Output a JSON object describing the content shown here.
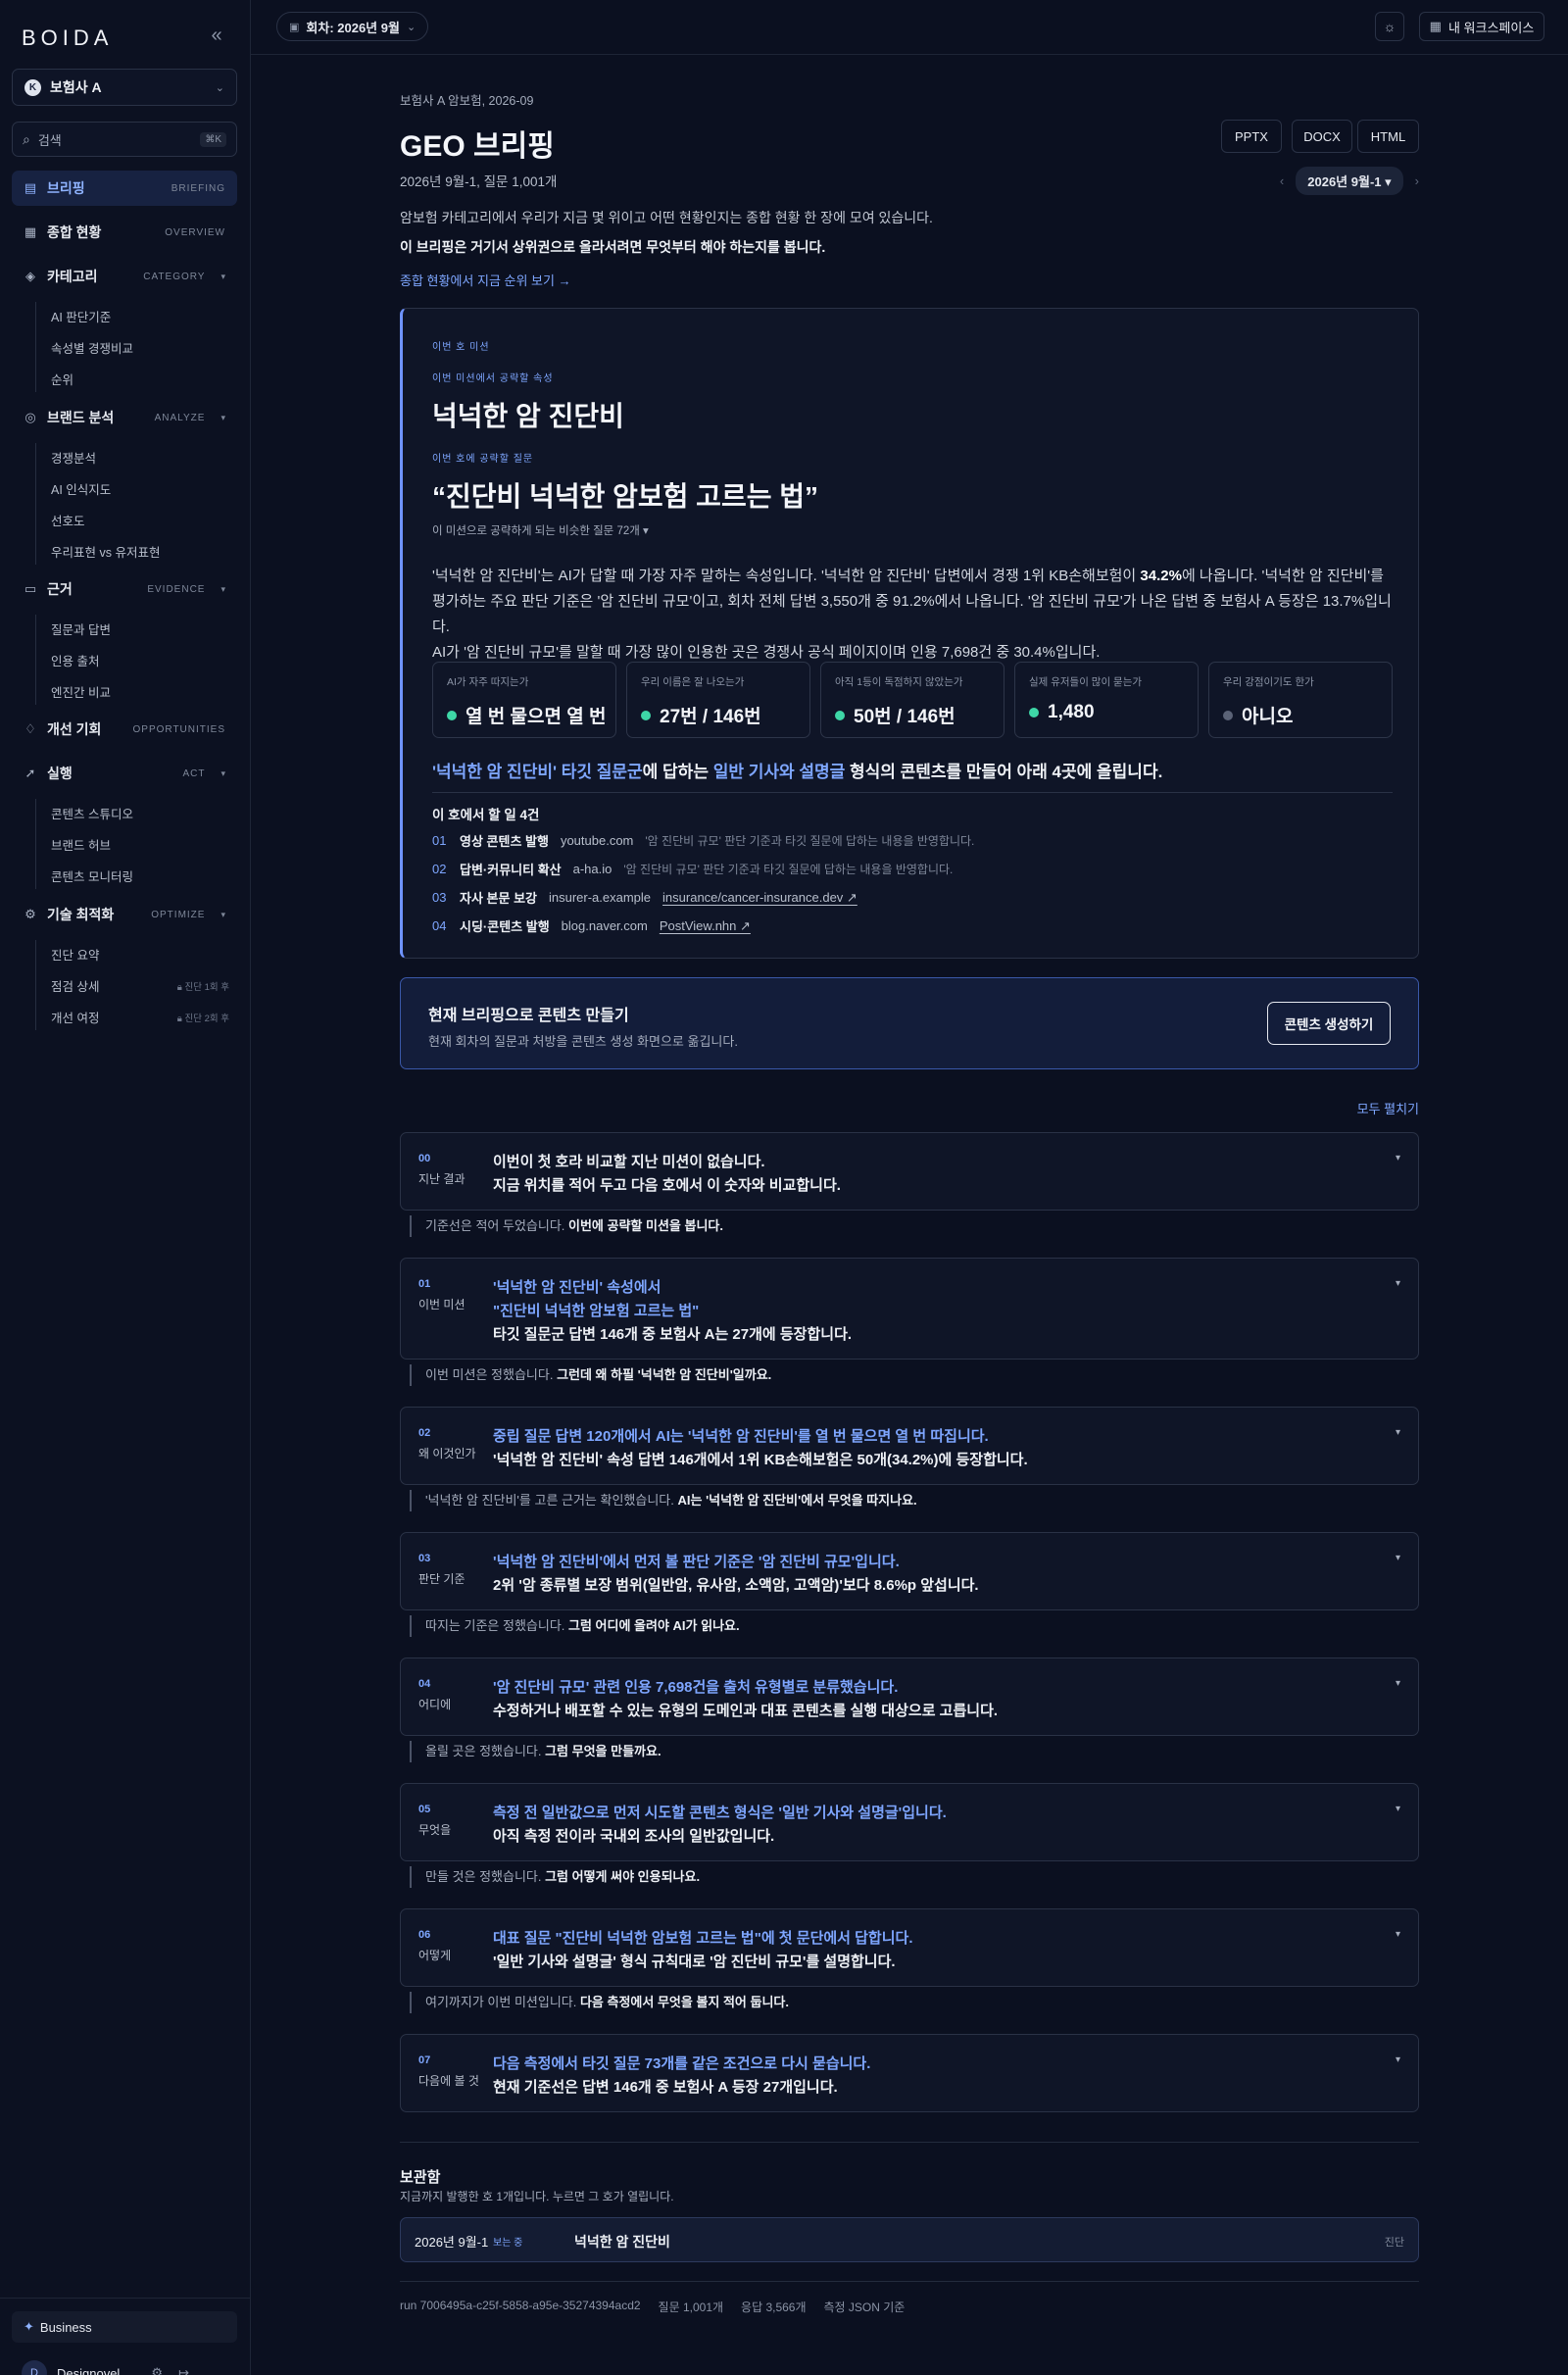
{
  "sidebar": {
    "logo": "BOIDA",
    "org": {
      "initial": "K",
      "name": "보험사 A"
    },
    "search": {
      "label": "검색",
      "shortcut": "⌘K"
    },
    "nav": [
      {
        "label": "브리핑",
        "en": "BRIEFING"
      },
      {
        "label": "종합 현황",
        "en": "OVERVIEW"
      },
      {
        "label": "카테고리",
        "en": "CATEGORY"
      },
      {
        "label": "브랜드 분석",
        "en": "ANALYZE"
      },
      {
        "label": "근거",
        "en": "EVIDENCE"
      },
      {
        "label": "개선 기회",
        "en": "OPPORTUNITIES"
      },
      {
        "label": "실행",
        "en": "ACT"
      },
      {
        "label": "기술 최적화",
        "en": "OPTIMIZE"
      }
    ],
    "category_items": [
      "AI 판단기준",
      "속성별 경쟁비교",
      "순위"
    ],
    "analyze_items": [
      "경쟁분석",
      "AI 인식지도",
      "선호도",
      "우리표현 vs 유저표현"
    ],
    "evidence_items": [
      "질문과 답변",
      "인용 출처",
      "엔진간 비교"
    ],
    "act_items": [
      "콘텐츠 스튜디오",
      "브랜드 허브",
      "콘텐츠 모니터링"
    ],
    "optimize_items": [
      {
        "label": "진단 요약",
        "lock": ""
      },
      {
        "label": "점검 상세",
        "lock": "진단 1회 후"
      },
      {
        "label": "개선 여정",
        "lock": "진단 2회 후"
      }
    ],
    "plan": "Business",
    "user": {
      "initial": "D",
      "name": "Designovel"
    }
  },
  "topbar": {
    "round": "회차: 2026년 9월",
    "workspace": "내 워크스페이스"
  },
  "header": {
    "crumb": "보험사 A 암보험, 2026-09",
    "title": "GEO 브리핑",
    "meta": "2026년 9월-1, 질문 1,001개",
    "exports": [
      "PPTX",
      "DOCX",
      "HTML"
    ],
    "round_pill": "2026년 9월-1"
  },
  "intro": {
    "line1": "암보험 카테고리에서 우리가 지금 몇 위이고 어떤 현황인지는 종합 현황 한 장에 모여 있습니다.",
    "line2": "이 브리핑은 거기서 상위권으로 올라서려면 무엇부터 해야 하는지를 봅니다.",
    "link": "종합 현황에서 지금 순위 보기 →"
  },
  "mission": {
    "tag": "이번 호 미션",
    "attr_tag": "이번 미션에서 공략할 속성",
    "attr": "넉넉한 암 진단비",
    "q_tag": "이번 호에 공략할 질문",
    "question": "“진단비 넉넉한 암보험 고르는 법”",
    "similar": "이 미션으로 공략하게 되는 비슷한 질문 72개 ▾",
    "para1a": "'넉넉한 암 진단비'는 AI가 답할 때 가장 자주 말하는 속성입니다. '넉넉한 암 진단비' 답변에서 경쟁 1위 KB손해보험이 ",
    "para1b": "34.2%",
    "para1c": "에 나옵니다. '넉넉한 암 진단비'를",
    "para2": "평가하는 주요 판단 기준은 '암 진단비 규모'이고, 회차 전체 답변 3,550개 중 91.2%에서 나옵니다. '암 진단비 규모'가 나온 답변 중 보험사 A 등장은 13.7%입니다.",
    "para3": "AI가 '암 진단비 규모'를 말할 때 가장 많이 인용한 곳은 경쟁사 공식 페이지이며 인용 7,698건 중 30.4%입니다.",
    "stats": [
      {
        "k": "AI가 자주 따지는가",
        "v": "열 번 물으면 열 번",
        "on": true
      },
      {
        "k": "우리 이름은 잘 나오는가",
        "v": "27번 / 146번",
        "on": true
      },
      {
        "k": "아직 1등이 독점하지 않았는가",
        "v": "50번 / 146번",
        "on": true
      },
      {
        "k": "실제 유저들이 많이 묻는가",
        "v": "1,480",
        "on": true
      },
      {
        "k": "우리 강점이기도 한가",
        "v": "아니오",
        "on": false
      }
    ],
    "headline_a": "'넉넉한 암 진단비' 타깃 질문군",
    "headline_b": "에 답하는 ",
    "headline_c": "일반 기사와 설명글",
    "headline_d": " 형식의 콘텐츠를 만들어 아래 4곳에 올립니다.",
    "todo_title": "이 호에서 할 일 4건",
    "todos": [
      {
        "n": "01",
        "action": "영상 콘텐츠 발행",
        "domain": "youtube.com",
        "note": "'암 진단비 규모' 판단 기준과 타깃 질문에 답하는 내용을 반영합니다.",
        "url": ""
      },
      {
        "n": "02",
        "action": "답변·커뮤니티 확산",
        "domain": "a-ha.io",
        "note": "'암 진단비 규모' 판단 기준과 타깃 질문에 답하는 내용을 반영합니다.",
        "url": ""
      },
      {
        "n": "03",
        "action": "자사 본문 보강",
        "domain": "insurer-a.example",
        "note": "",
        "url": "insurance/cancer-insurance.dev ↗"
      },
      {
        "n": "04",
        "action": "시딩·콘텐츠 발행",
        "domain": "blog.naver.com",
        "note": "",
        "url": "PostView.nhn ↗"
      }
    ]
  },
  "cta": {
    "title": "현재 브리핑으로 콘텐츠 만들기",
    "sub": "현재 회차의 질문과 처방을 콘텐츠 생성 화면으로 옮깁니다.",
    "button": "콘텐츠 생성하기"
  },
  "expand_all": "모두 펼치기",
  "steps": [
    {
      "n": "00",
      "label": "지난 결과",
      "l1": "이번이 첫 호라 비교할 지난 미션이 없습니다.",
      "l2": "지금 위치를 적어 두고 다음 호에서 이 숫자와 비교합니다.",
      "l3": ""
    },
    {
      "n": "01",
      "label": "이번 미션",
      "l1": "'넉넉한 암 진단비' 속성에서",
      "l2": "\"진단비 넉넉한 암보험 고르는 법\"",
      "l3": "타깃 질문군 답변 146개 중 보험사 A는 27개에 등장합니다."
    },
    {
      "n": "02",
      "label": "왜 이것인가",
      "l1": "중립 질문 답변 120개에서 AI는 '넉넉한 암 진단비'를 열 번 물으면 열 번 따집니다.",
      "l2": "'넉넉한 암 진단비' 속성 답변 146개에서 1위 KB손해보험은 50개(34.2%)에 등장합니다.",
      "l3": ""
    },
    {
      "n": "03",
      "label": "판단 기준",
      "l1": "'넉넉한 암 진단비'에서 먼저 볼 판단 기준은 '암 진단비 규모'입니다.",
      "l2": "2위 '암 종류별 보장 범위(일반암, 유사암, 소액암, 고액암)'보다 8.6%p 앞섭니다.",
      "l3": ""
    },
    {
      "n": "04",
      "label": "어디에",
      "l1": "'암 진단비 규모' 관련 인용 7,698건을 출처 유형별로 분류했습니다.",
      "l2": "수정하거나 배포할 수 있는 유형의 도메인과 대표 콘텐츠를 실행 대상으로 고릅니다.",
      "l3": ""
    },
    {
      "n": "05",
      "label": "무엇을",
      "l1": "측정 전 일반값으로 먼저 시도할 콘텐츠 형식은 '일반 기사와 설명글'입니다.",
      "l2": "아직 측정 전이라 국내외 조사의 일반값입니다.",
      "l3": ""
    },
    {
      "n": "06",
      "label": "어떻게",
      "l1": "대표 질문 \"진단비 넉넉한 암보험 고르는 법\"에 첫 문단에서 답합니다.",
      "l2": "'일반 기사와 설명글' 형식 규칙대로 '암 진단비 규모'를 설명합니다.",
      "l3": ""
    },
    {
      "n": "07",
      "label": "다음에 볼 것",
      "l1": "다음 측정에서 타깃 질문 73개를 같은 조건으로 다시 묻습니다.",
      "l2": "현재 기준선은 답변 146개 중 보험사 A 등장 27개입니다.",
      "l3": ""
    }
  ],
  "bridges": [
    {
      "a": "기준선은 적어 두었습니다. ",
      "b": "이번에 공략할 미션을 봅니다."
    },
    {
      "a": "이번 미션은 정했습니다. ",
      "b": "그런데 왜 하필 '넉넉한 암 진단비'일까요."
    },
    {
      "a": "'넉넉한 암 진단비'를 고른 근거는 확인했습니다. ",
      "b": "AI는 '넉넉한 암 진단비'에서 무엇을 따지나요."
    },
    {
      "a": "따지는 기준은 정했습니다. ",
      "b": "그럼 어디에 올려야 AI가 읽나요."
    },
    {
      "a": "올릴 곳은 정했습니다. ",
      "b": "그럼 무엇을 만들까요."
    },
    {
      "a": "만들 것은 정했습니다. ",
      "b": "그럼 어떻게 써야 인용되나요."
    },
    {
      "a": "여기까지가 이번 미션입니다. ",
      "b": "다음 측정에서 무엇을 볼지 적어 둡니다."
    }
  ],
  "archive": {
    "title": "보관함",
    "sub": "지금까지 발행한 호 1개입니다. 누르면 그 호가 열립니다.",
    "row": {
      "round": "2026년 9월-1",
      "badge": "보는 중",
      "name": "넉넉한 암 진단비",
      "kind": "진단"
    }
  },
  "footer": {
    "run": "run 7006495a-c25f-5858-a95e-35274394acd2",
    "questions": "질문 1,001개",
    "answers": "응답 3,566개",
    "basis": "측정 JSON 기준"
  }
}
